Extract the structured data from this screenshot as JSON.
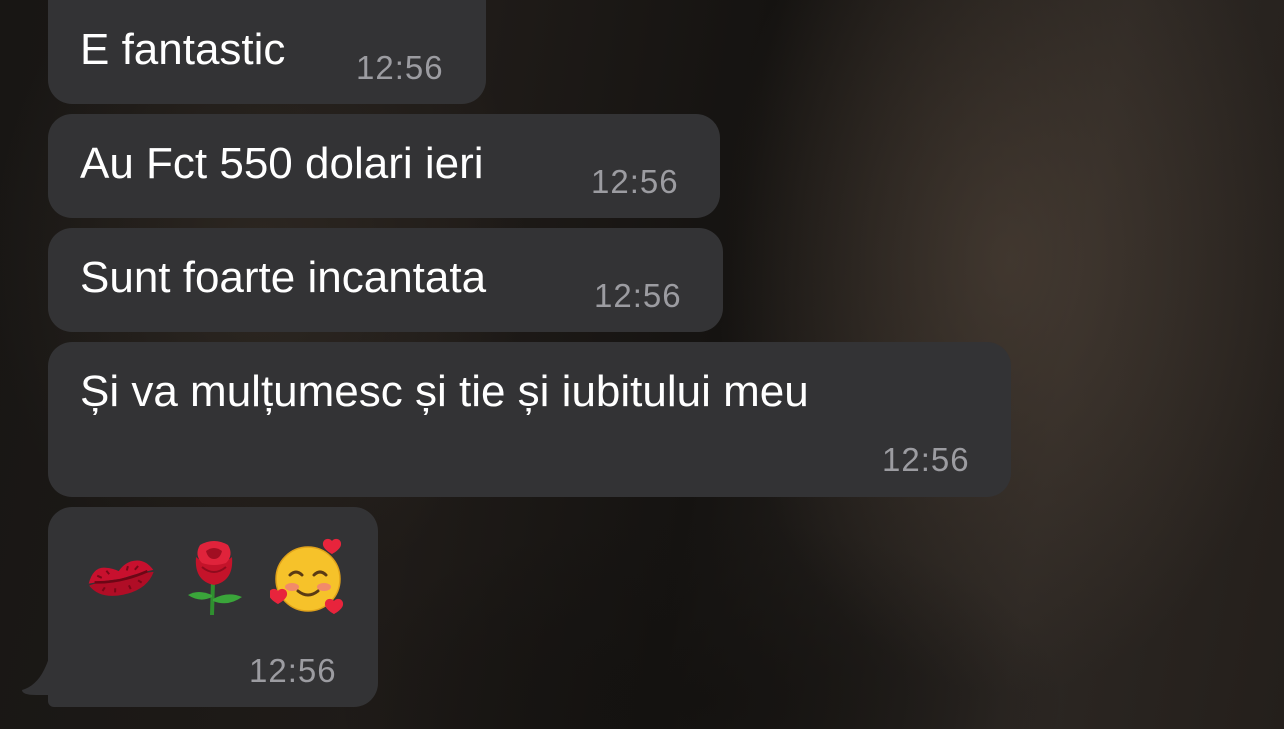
{
  "messages": [
    {
      "text": "E fantastic",
      "time": "12:56"
    },
    {
      "text": "Au Fct 550 dolari ieri",
      "time": "12:56"
    },
    {
      "text": "Sunt foarte incantata",
      "time": "12:56"
    },
    {
      "text": "Și va mulțumesc și tie și iubitului meu",
      "time": "12:56"
    },
    {
      "emojis": [
        "kiss-mark-icon",
        "rose-icon",
        "smiling-face-with-hearts-icon"
      ],
      "time": "12:56"
    }
  ],
  "colors": {
    "bubble": "#333335",
    "text": "#ffffff",
    "timestamp": "#9c9ca1"
  }
}
